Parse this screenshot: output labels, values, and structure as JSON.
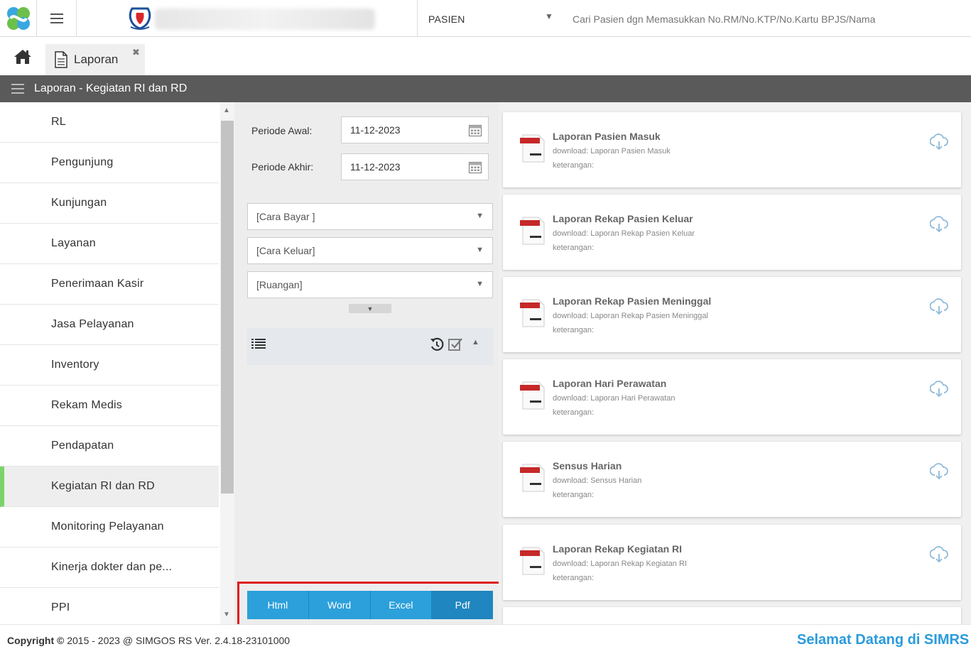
{
  "topbar": {
    "search_type": "PASIEN",
    "search_placeholder": "Cari Pasien dgn Memasukkan No.RM/No.KTP/No.Kartu BPJS/Nama"
  },
  "tabs": [
    {
      "label": "Laporan"
    }
  ],
  "section": {
    "title": "Laporan - Kegiatan RI dan RD"
  },
  "sidebar": {
    "items": [
      {
        "label": "RL"
      },
      {
        "label": "Pengunjung"
      },
      {
        "label": "Kunjungan"
      },
      {
        "label": "Layanan"
      },
      {
        "label": "Penerimaan Kasir"
      },
      {
        "label": "Jasa Pelayanan"
      },
      {
        "label": "Inventory"
      },
      {
        "label": "Rekam Medis"
      },
      {
        "label": "Pendapatan"
      },
      {
        "label": "Kegiatan RI dan RD"
      },
      {
        "label": "Monitoring Pelayanan"
      },
      {
        "label": "Kinerja dokter dan pe..."
      },
      {
        "label": "PPI"
      }
    ],
    "active_index": 9
  },
  "filter": {
    "periode_awal_label": "Periode Awal:",
    "periode_awal_value": "11-12-2023",
    "periode_akhir_label": "Periode Akhir:",
    "periode_akhir_value": "11-12-2023",
    "cara_bayar": "[Cara Bayar ]",
    "cara_keluar": "[Cara Keluar]",
    "ruangan": "[Ruangan]"
  },
  "export": {
    "html": "Html",
    "word": "Word",
    "excel": "Excel",
    "pdf": "Pdf"
  },
  "reports": [
    {
      "title": "Laporan Pasien Masuk",
      "download": "download: Laporan Pasien Masuk",
      "keterangan": "keterangan:"
    },
    {
      "title": "Laporan Rekap Pasien Keluar",
      "download": "download: Laporan Rekap Pasien Keluar",
      "keterangan": "keterangan:"
    },
    {
      "title": "Laporan Rekap Pasien Meninggal",
      "download": "download: Laporan Rekap Pasien Meninggal",
      "keterangan": "keterangan:"
    },
    {
      "title": "Laporan Hari Perawatan",
      "download": "download: Laporan Hari Perawatan",
      "keterangan": "keterangan:"
    },
    {
      "title": "Sensus Harian",
      "download": "download: Sensus Harian",
      "keterangan": "keterangan:"
    },
    {
      "title": "Laporan Rekap Kegiatan RI",
      "download": "download: Laporan Rekap Kegiatan RI",
      "keterangan": "keterangan:"
    }
  ],
  "footer": {
    "copyright_label": "Copyright",
    "copyright_text": "2015 - 2023 @ SIMGOS RS Ver. 2.4.18-23101000",
    "welcome": "Selamat Datang di SIMRS"
  },
  "colors": {
    "header_bg": "#5a5a5a",
    "accent_green": "#7bd46a",
    "button_blue": "#2ca0db",
    "highlight_red": "#e01a1a",
    "welcome_blue": "#2a9bdc"
  },
  "icons": [
    "app-logo-icon",
    "hamburger-icon",
    "hospital-logo-icon",
    "chevron-down-icon",
    "home-icon",
    "document-icon",
    "close-icon",
    "calendar-icon",
    "list-icon",
    "refresh-icon",
    "check-icon",
    "chevron-up-icon",
    "pdf-file-icon",
    "cloud-download-icon",
    "copyright-icon"
  ]
}
